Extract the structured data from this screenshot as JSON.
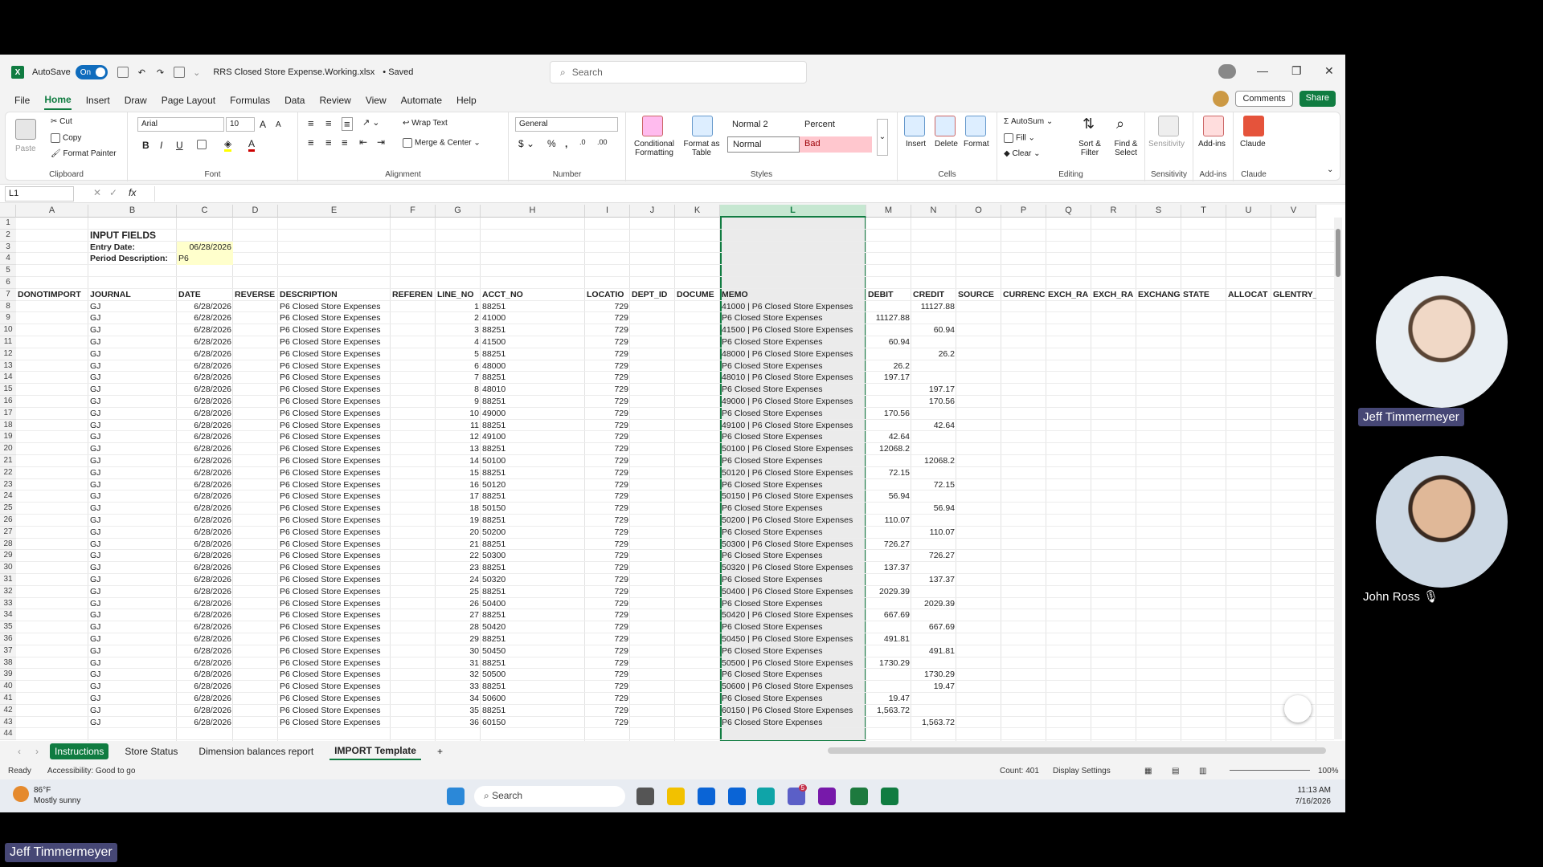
{
  "window": {
    "autosave_label": "AutoSave",
    "autosave_state": "On",
    "file_name": "RRS Closed Store Expense.Working.xlsx",
    "save_state": "• Saved",
    "search_placeholder": "Search"
  },
  "menu": [
    "File",
    "Home",
    "Insert",
    "Draw",
    "Page Layout",
    "Formulas",
    "Data",
    "Review",
    "View",
    "Automate",
    "Help"
  ],
  "menu_right": {
    "comments": "Comments",
    "share": "Share"
  },
  "ribbon": {
    "clipboard": {
      "paste": "Paste",
      "cut": "Cut",
      "copy": "Copy",
      "format_painter": "Format Painter",
      "label": "Clipboard"
    },
    "font": {
      "name": "Arial",
      "size": "10",
      "label": "Font"
    },
    "alignment": {
      "wrap": "Wrap Text",
      "merge": "Merge & Center",
      "label": "Alignment"
    },
    "number": {
      "format": "General",
      "label": "Number"
    },
    "styles": {
      "cond": "Conditional Formatting",
      "table": "Format as Table",
      "normal2": "Normal 2",
      "percent": "Percent",
      "normal": "Normal",
      "bad": "Bad",
      "label": "Styles"
    },
    "cells": {
      "insert": "Insert",
      "delete": "Delete",
      "format": "Format",
      "label": "Cells"
    },
    "editing": {
      "autosum": "AutoSum",
      "fill": "Fill",
      "clear": "Clear",
      "sort": "Sort & Filter",
      "find": "Find & Select",
      "label": "Editing"
    },
    "sensitivity": {
      "btn": "Sensitivity",
      "label": "Sensitivity"
    },
    "addins": {
      "btn": "Add-ins",
      "label": "Add-ins"
    },
    "claude": {
      "btn": "Claude",
      "label": "Claude"
    }
  },
  "formula_bar": {
    "name_box": "L1",
    "fx": "fx"
  },
  "columns": [
    "A",
    "B",
    "C",
    "D",
    "E",
    "F",
    "G",
    "H",
    "I",
    "J",
    "K",
    "L",
    "M",
    "N",
    "O",
    "P",
    "Q",
    "R",
    "S",
    "T",
    "U",
    "V"
  ],
  "input_fields": {
    "title": "INPUT FIELDS",
    "entry_date_label": "Entry Date:",
    "entry_date": "06/28/2026",
    "period_label": "Period Description:",
    "period": "P6"
  },
  "headers": [
    "DONOTIMPORT",
    "JOURNAL",
    "DATE",
    "REVERSE",
    "DESCRIPTION",
    "REFEREN",
    "LINE_NO",
    "ACCT_NO",
    "LOCATIO",
    "DEPT_ID",
    "DOCUME",
    "MEMO",
    "DEBIT",
    "CREDIT",
    "SOURCE",
    "CURRENC",
    "EXCH_RA",
    "EXCH_RA",
    "EXCHANG",
    "STATE",
    "ALLOCAT",
    "GLENTRY_VE"
  ],
  "rows": [
    {
      "line": "1",
      "acct": "88251",
      "memo": "41000 | P6 Closed Store Expenses",
      "debit": "",
      "credit": "11127.88"
    },
    {
      "line": "2",
      "acct": "41000",
      "memo": "P6 Closed Store Expenses",
      "debit": "11127.88",
      "credit": ""
    },
    {
      "line": "3",
      "acct": "88251",
      "memo": "41500 | P6 Closed Store Expenses",
      "debit": "",
      "credit": "60.94"
    },
    {
      "line": "4",
      "acct": "41500",
      "memo": "P6 Closed Store Expenses",
      "debit": "60.94",
      "credit": ""
    },
    {
      "line": "5",
      "acct": "88251",
      "memo": "48000 | P6 Closed Store Expenses",
      "debit": "",
      "credit": "26.2"
    },
    {
      "line": "6",
      "acct": "48000",
      "memo": "P6 Closed Store Expenses",
      "debit": "26.2",
      "credit": ""
    },
    {
      "line": "7",
      "acct": "88251",
      "memo": "48010 | P6 Closed Store Expenses",
      "debit": "197.17",
      "credit": ""
    },
    {
      "line": "8",
      "acct": "48010",
      "memo": "P6 Closed Store Expenses",
      "debit": "",
      "credit": "197.17"
    },
    {
      "line": "9",
      "acct": "88251",
      "memo": "49000 | P6 Closed Store Expenses",
      "debit": "",
      "credit": "170.56"
    },
    {
      "line": "10",
      "acct": "49000",
      "memo": "P6 Closed Store Expenses",
      "debit": "170.56",
      "credit": ""
    },
    {
      "line": "11",
      "acct": "88251",
      "memo": "49100 | P6 Closed Store Expenses",
      "debit": "",
      "credit": "42.64"
    },
    {
      "line": "12",
      "acct": "49100",
      "memo": "P6 Closed Store Expenses",
      "debit": "42.64",
      "credit": ""
    },
    {
      "line": "13",
      "acct": "88251",
      "memo": "50100 | P6 Closed Store Expenses",
      "debit": "12068.2",
      "credit": ""
    },
    {
      "line": "14",
      "acct": "50100",
      "memo": "P6 Closed Store Expenses",
      "debit": "",
      "credit": "12068.2"
    },
    {
      "line": "15",
      "acct": "88251",
      "memo": "50120 | P6 Closed Store Expenses",
      "debit": "72.15",
      "credit": ""
    },
    {
      "line": "16",
      "acct": "50120",
      "memo": "P6 Closed Store Expenses",
      "debit": "",
      "credit": "72.15"
    },
    {
      "line": "17",
      "acct": "88251",
      "memo": "50150 | P6 Closed Store Expenses",
      "debit": "56.94",
      "credit": ""
    },
    {
      "line": "18",
      "acct": "50150",
      "memo": "P6 Closed Store Expenses",
      "debit": "",
      "credit": "56.94"
    },
    {
      "line": "19",
      "acct": "88251",
      "memo": "50200 | P6 Closed Store Expenses",
      "debit": "110.07",
      "credit": ""
    },
    {
      "line": "20",
      "acct": "50200",
      "memo": "P6 Closed Store Expenses",
      "debit": "",
      "credit": "110.07"
    },
    {
      "line": "21",
      "acct": "88251",
      "memo": "50300 | P6 Closed Store Expenses",
      "debit": "726.27",
      "credit": ""
    },
    {
      "line": "22",
      "acct": "50300",
      "memo": "P6 Closed Store Expenses",
      "debit": "",
      "credit": "726.27"
    },
    {
      "line": "23",
      "acct": "88251",
      "memo": "50320 | P6 Closed Store Expenses",
      "debit": "137.37",
      "credit": ""
    },
    {
      "line": "24",
      "acct": "50320",
      "memo": "P6 Closed Store Expenses",
      "debit": "",
      "credit": "137.37"
    },
    {
      "line": "25",
      "acct": "88251",
      "memo": "50400 | P6 Closed Store Expenses",
      "debit": "2029.39",
      "credit": ""
    },
    {
      "line": "26",
      "acct": "50400",
      "memo": "P6 Closed Store Expenses",
      "debit": "",
      "credit": "2029.39"
    },
    {
      "line": "27",
      "acct": "88251",
      "memo": "50420 | P6 Closed Store Expenses",
      "debit": "667.69",
      "credit": ""
    },
    {
      "line": "28",
      "acct": "50420",
      "memo": "P6 Closed Store Expenses",
      "debit": "",
      "credit": "667.69"
    },
    {
      "line": "29",
      "acct": "88251",
      "memo": "50450 | P6 Closed Store Expenses",
      "debit": "491.81",
      "credit": ""
    },
    {
      "line": "30",
      "acct": "50450",
      "memo": "P6 Closed Store Expenses",
      "debit": "",
      "credit": "491.81"
    },
    {
      "line": "31",
      "acct": "88251",
      "memo": "50500 | P6 Closed Store Expenses",
      "debit": "1730.29",
      "credit": ""
    },
    {
      "line": "32",
      "acct": "50500",
      "memo": "P6 Closed Store Expenses",
      "debit": "",
      "credit": "1730.29"
    },
    {
      "line": "33",
      "acct": "88251",
      "memo": "50600 | P6 Closed Store Expenses",
      "debit": "",
      "credit": "19.47"
    },
    {
      "line": "34",
      "acct": "50600",
      "memo": "P6 Closed Store Expenses",
      "debit": "19.47",
      "credit": ""
    },
    {
      "line": "35",
      "acct": "88251",
      "memo": "60150 | P6 Closed Store Expenses",
      "debit": "1,563.72",
      "credit": ""
    },
    {
      "line": "36",
      "acct": "60150",
      "memo": "P6 Closed Store Expenses",
      "debit": "",
      "credit": "1,563.72"
    }
  ],
  "row_constants": {
    "journal": "GJ",
    "date": "6/28/2026",
    "description": "P6 Closed Store Expenses",
    "location": "729"
  },
  "sheet_tabs": [
    "Instructions",
    "Store Status",
    "Dimension balances report",
    "IMPORT Template"
  ],
  "status": {
    "ready": "Ready",
    "accessibility": "Accessibility: Good to go",
    "count": "Count: 401",
    "display": "Display Settings",
    "zoom": "100%"
  },
  "taskbar": {
    "temp": "86°F",
    "weather": "Mostly sunny",
    "search": "Search",
    "time": "11:13 AM",
    "date": "7/16/2026",
    "badge": "5"
  },
  "participants": [
    {
      "name": "Jeff Timmermeyer"
    },
    {
      "name": "John Ross"
    }
  ],
  "self_label": "Jeff Timmermeyer",
  "colors": {
    "excel_green": "#107c41",
    "bad_fill": "#ffc7ce",
    "bad_text": "#9c0006",
    "teams_tag": "#464775"
  }
}
